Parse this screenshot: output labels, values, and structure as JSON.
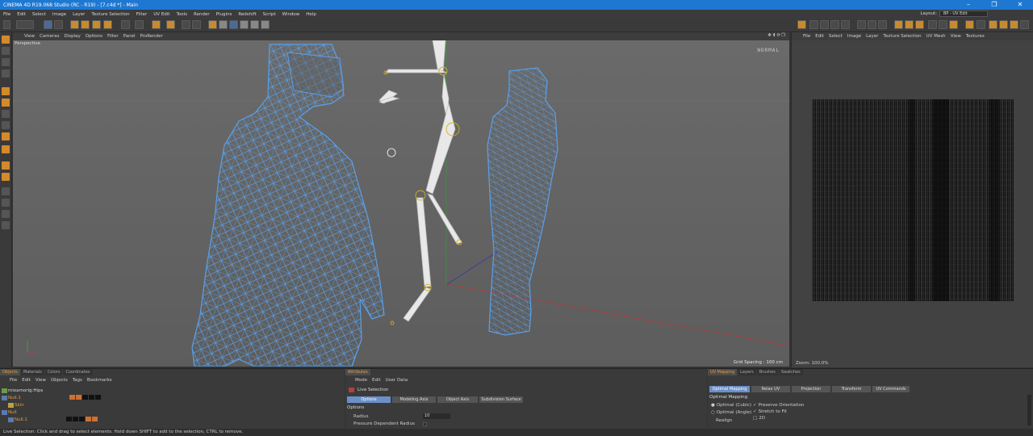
{
  "window": {
    "title": "CINEMA 4D R19.068 Studio (RC - R19) - [7.c4d *] - Main",
    "min": "–",
    "max": "❐",
    "close": "✕"
  },
  "menubar": {
    "items": [
      "File",
      "Edit",
      "Select",
      "Image",
      "Layer",
      "Texture Selection",
      "Filter",
      "UV Edit",
      "Tools",
      "Render",
      "Plugins",
      "Redshift",
      "Script",
      "Window",
      "Help"
    ],
    "layout_label": "Layout:",
    "layout_value": "BP - UV Edit"
  },
  "viewport": {
    "menu": [
      "View",
      "Cameras",
      "Display",
      "Options",
      "Filter",
      "Panel",
      "ProRender"
    ],
    "camera": "Perspective",
    "mode": "NORMAL",
    "grid_spacing": "Grid Spacing : 100 cm",
    "nav": "✥⬍⟳❐"
  },
  "uv_view": {
    "menu": [
      "File",
      "Edit",
      "Select",
      "Image",
      "Layer",
      "Texture Selection",
      "UV Mesh",
      "View",
      "Textures"
    ],
    "zoom": "Zoom: 100.0%"
  },
  "objects_panel": {
    "tabs": [
      "Objects",
      "Materials",
      "Colors",
      "Coordinates"
    ],
    "menu": [
      "File",
      "Edit",
      "View",
      "Objects",
      "Tags",
      "Bookmarks"
    ],
    "rows": [
      {
        "name": "mixamorig:Hips"
      },
      {
        "name": "Null.1"
      },
      {
        "name": "Skin"
      },
      {
        "name": "Null"
      },
      {
        "name": "Null.1"
      }
    ]
  },
  "attributes_panel": {
    "tabs": [
      "Attributes"
    ],
    "menu": [
      "Mode",
      "Edit",
      "User Data"
    ],
    "tool": "Live Selection",
    "subtabs": [
      "Options",
      "Modeling Axis",
      "Object Axis",
      "Subdivision Surface"
    ],
    "section": "Options",
    "radius_label": "Radius",
    "radius_value": "10",
    "pressure_label": "Pressure Dependent Radius"
  },
  "uvmap_panel": {
    "tabs": [
      "UV Mapping",
      "Layers",
      "Brushes",
      "Swatches"
    ],
    "subtabs": [
      "Optimal Mapping",
      "Relax UV",
      "Projection",
      "Transform",
      "UV Commands"
    ],
    "section": "Optimal Mapping",
    "opt1": "Optimal (Cubic)",
    "opt2": "Optimal (Angle)",
    "opt3": "Realign",
    "chk1": "Preserve Orientation",
    "chk2": "Stretch to Fit",
    "chk3": "2D"
  },
  "status": "Live Selection: Click and drag to select elements. Hold down SHIFT to add to the selection, CTRL to remove."
}
